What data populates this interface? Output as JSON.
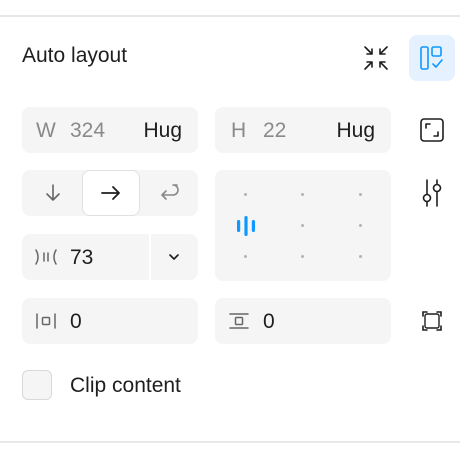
{
  "section": {
    "title": "Auto layout",
    "header_icons": [
      "collapse-icon",
      "layout-suggest-icon"
    ]
  },
  "width": {
    "label": "W",
    "value": "324",
    "mode": "Hug"
  },
  "height": {
    "label": "H",
    "value": "22",
    "mode": "Hug"
  },
  "direction": {
    "options": [
      "vertical",
      "horizontal",
      "wrap"
    ],
    "selected": "horizontal"
  },
  "alignment": {
    "selected": "middle-left"
  },
  "gap": {
    "value": "73"
  },
  "padding": {
    "horizontal": "0",
    "vertical": "0"
  },
  "clip": {
    "label": "Clip content",
    "checked": false
  },
  "colors": {
    "accent": "#0d99ff",
    "field_bg": "#f5f5f5",
    "active_bg": "#e5f1ff"
  }
}
